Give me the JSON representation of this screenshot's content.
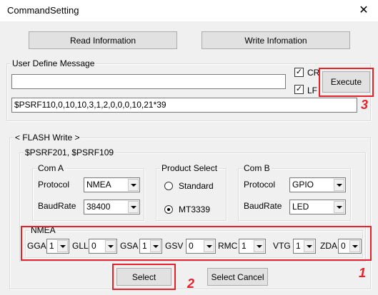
{
  "window": {
    "title": "CommandSetting",
    "close_label": "✕"
  },
  "toolbar": {
    "read_label": "Read Information",
    "write_label": "Write Infomation"
  },
  "user_define": {
    "group_label": "User Define Message",
    "input_value": "",
    "cr_label": "CR",
    "lf_label": "LF",
    "cr_checked": true,
    "lf_checked": true,
    "execute_label": "Execute",
    "message_value": "$PSRF110,0,10,10,3,1,2,0,0,0,10,21*39"
  },
  "flash": {
    "group_label": "< FLASH Write >",
    "sub_label": "$PSRF201, $PSRF109",
    "com_a": {
      "label": "Com A",
      "protocol_label": "Protocol",
      "protocol_value": "NMEA",
      "baud_label": "BaudRate",
      "baud_value": "38400"
    },
    "product": {
      "label": "Product Select",
      "option_standard": "Standard",
      "option_mt3339": "MT3339",
      "selected": "MT3339"
    },
    "com_b": {
      "label": "Com B",
      "protocol_label": "Protocol",
      "protocol_value": "GPIO",
      "baud_label": "BaudRate",
      "baud_value": "LED"
    },
    "nmea": {
      "label": "NMEA",
      "fields": [
        {
          "name": "GGA",
          "value": "1"
        },
        {
          "name": "GLL",
          "value": "0"
        },
        {
          "name": "GSA",
          "value": "1"
        },
        {
          "name": "GSV",
          "value": "0"
        },
        {
          "name": "RMC",
          "value": "1"
        },
        {
          "name": "VTG",
          "value": "1"
        },
        {
          "name": "ZDA",
          "value": "0"
        }
      ]
    },
    "select_label": "Select",
    "select_cancel_label": "Select Cancel"
  },
  "annotations": {
    "num1": "1",
    "num2": "2",
    "num3": "3",
    "color": "#e8202a"
  }
}
